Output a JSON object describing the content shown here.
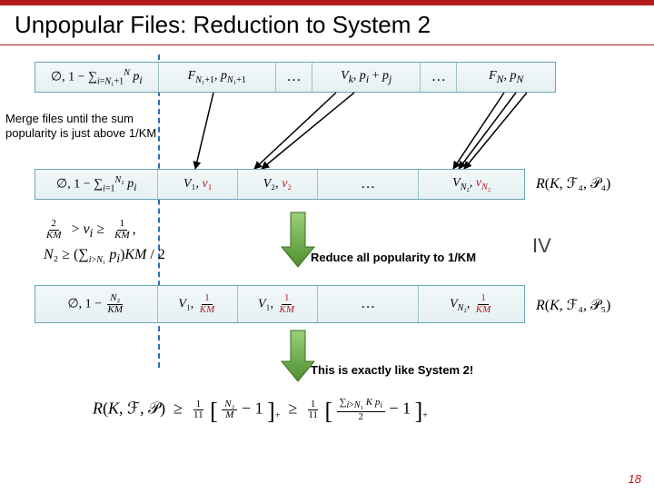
{
  "header": {
    "title": "Unpopular Files: Reduction to System 2"
  },
  "step_label": "IV",
  "page_number": "18",
  "notes": {
    "merge": "Merge files until the sum\npopularity is just above 1/KM",
    "reduce": "Reduce all popularity to 1/KM",
    "system2": "This is exactly like System 2!"
  },
  "box1": {
    "cells": [
      "∅, 1 − ∑_{i=N₁+1}^{N} p_i",
      "F_{N₁+1}, p_{N₁+1}",
      "…",
      "V_k, p_i + p_j",
      "…",
      "F_N, p_N"
    ]
  },
  "box2": {
    "cells": [
      "∅, 1 − ∑_{i=1}^{N₂} p_i",
      "V₁, v₁",
      "V₂, v₂",
      "…",
      "V_{N₂}, v_{N₂}"
    ],
    "rhs": "R(K, ℱ₄, 𝒫₄)"
  },
  "box3": {
    "cells": [
      "∅, 1 − N₂/KM",
      "V₁, 1/KM",
      "V₁, 1/KM",
      "…",
      "V_{N₂}, 1/KM"
    ],
    "rhs": "R(K, ℱ₄, 𝒫₅)"
  },
  "inequality": {
    "line1": "2/KM > v_i ≥ 1/KM,",
    "line2": "N₂ ≥ (∑_{i>N₁} p_i) KM / 2"
  },
  "final": "R(K, ℱ, 𝒫) ≥ (1/11)[ N₂/M − 1 ]_+ ≥ (1/11)[ (∑_{i>N₁} K p_i)/2 − 1 ]_+",
  "chart_data": {
    "type": "table",
    "note": "Presentation slide depicting three file-list rows and mathematical relations; not a numeric data chart."
  }
}
